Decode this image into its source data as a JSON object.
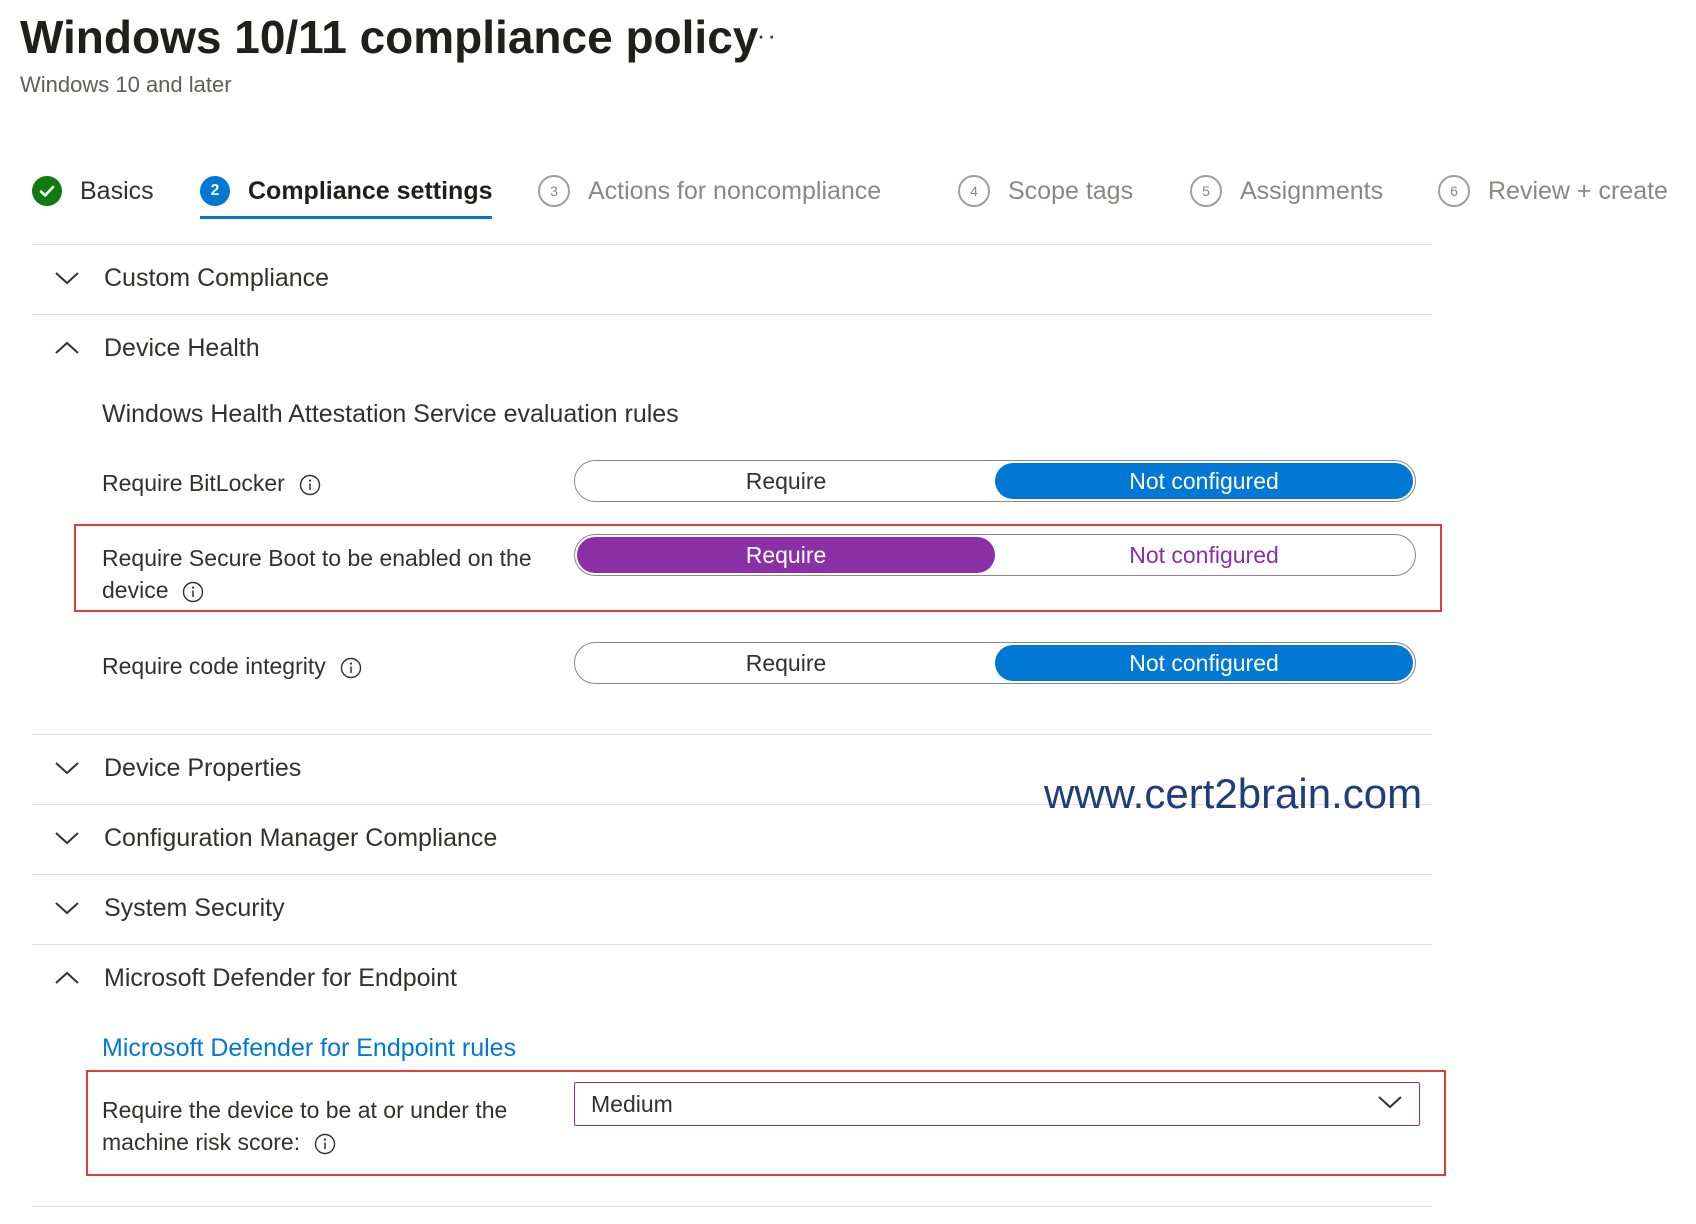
{
  "header": {
    "title": "Windows 10/11 compliance policy",
    "subtitle": "Windows 10 and later",
    "more_label": "···"
  },
  "wizard": {
    "steps": [
      {
        "number": "",
        "label": "Basics",
        "state": "completed"
      },
      {
        "number": "2",
        "label": "Compliance settings",
        "state": "active"
      },
      {
        "number": "3",
        "label": "Actions for noncompliance",
        "state": "pending"
      },
      {
        "number": "4",
        "label": "Scope tags",
        "state": "pending"
      },
      {
        "number": "5",
        "label": "Assignments",
        "state": "pending"
      },
      {
        "number": "6",
        "label": "Review + create",
        "state": "pending"
      }
    ]
  },
  "sections": {
    "custom_compliance": {
      "label": "Custom Compliance",
      "expanded": false
    },
    "device_health": {
      "label": "Device Health",
      "expanded": true,
      "subheading": "Windows Health Attestation Service evaluation rules",
      "settings": [
        {
          "label": "Require BitLocker",
          "options": [
            "Require",
            "Not configured"
          ],
          "selected": "Not configured"
        },
        {
          "label": "Require Secure Boot to be enabled on the device",
          "options": [
            "Require",
            "Not configured"
          ],
          "selected": "Require"
        },
        {
          "label": "Require code integrity",
          "options": [
            "Require",
            "Not configured"
          ],
          "selected": "Not configured"
        }
      ]
    },
    "device_properties": {
      "label": "Device Properties",
      "expanded": false
    },
    "config_manager": {
      "label": "Configuration Manager Compliance",
      "expanded": false
    },
    "system_security": {
      "label": "System Security",
      "expanded": false
    },
    "defender": {
      "label": "Microsoft Defender for Endpoint",
      "expanded": true,
      "rules_link": "Microsoft Defender for Endpoint rules",
      "risk_setting": {
        "label": "Require the device to be at or under the machine risk score:",
        "value": "Medium"
      }
    }
  },
  "watermark": "www.cert2brain.com",
  "colors": {
    "accent_blue": "#0078d4",
    "selected_purple": "#8b2fa6",
    "success_green": "#107c10",
    "highlight_red": "#e03c3c"
  }
}
